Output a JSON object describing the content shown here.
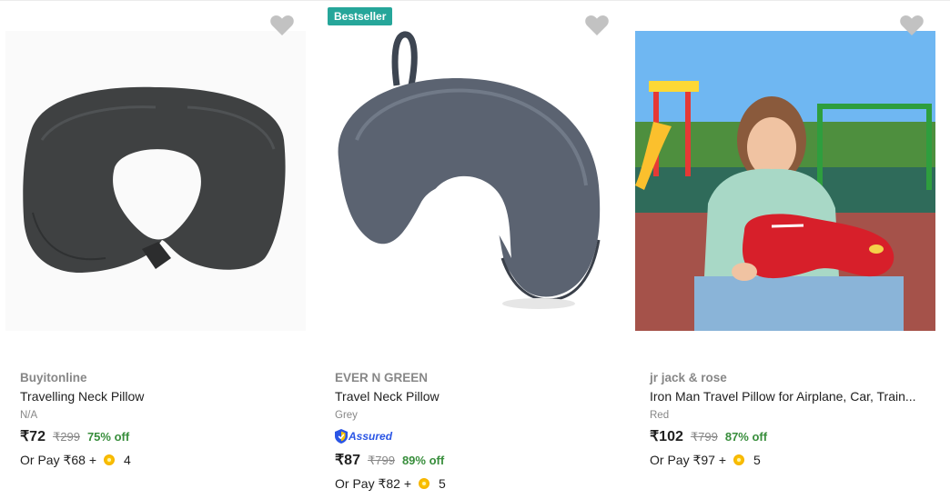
{
  "products": [
    {
      "brand": "Buyitonline",
      "title": "Travelling Neck Pillow",
      "variant": "N/A",
      "price": "₹72",
      "mrp": "₹299",
      "discount": "75% off",
      "or_pay": "Or Pay ₹68 +",
      "coins": "4",
      "wishlist_icon": "heart-icon",
      "image_desc": "dark grey inflatable neck pillow"
    },
    {
      "badge": "Bestseller",
      "brand": "EVER N GREEN",
      "title": "Travel Neck Pillow",
      "variant": "Grey",
      "assured": "Assured",
      "price": "₹87",
      "mrp": "₹799",
      "discount": "89% off",
      "or_pay": "Or Pay ₹82 +",
      "coins": "5",
      "wishlist_icon": "heart-icon",
      "image_desc": "grey velvet memory foam neck pillow with loop"
    },
    {
      "brand": "jr jack & rose",
      "title": "Iron Man Travel Pillow for Airplane, Car, Train...",
      "variant": "Red",
      "price": "₹102",
      "mrp": "₹799",
      "discount": "87% off",
      "or_pay": "Or Pay ₹97 +",
      "coins": "5",
      "wishlist_icon": "heart-icon",
      "image_desc": "girl holding red neck pillow at playground"
    }
  ],
  "colors": {
    "discount_green": "#388e3c",
    "badge_teal": "#26a69a",
    "assured_blue": "#2a55e5",
    "muted_grey": "#878787"
  }
}
